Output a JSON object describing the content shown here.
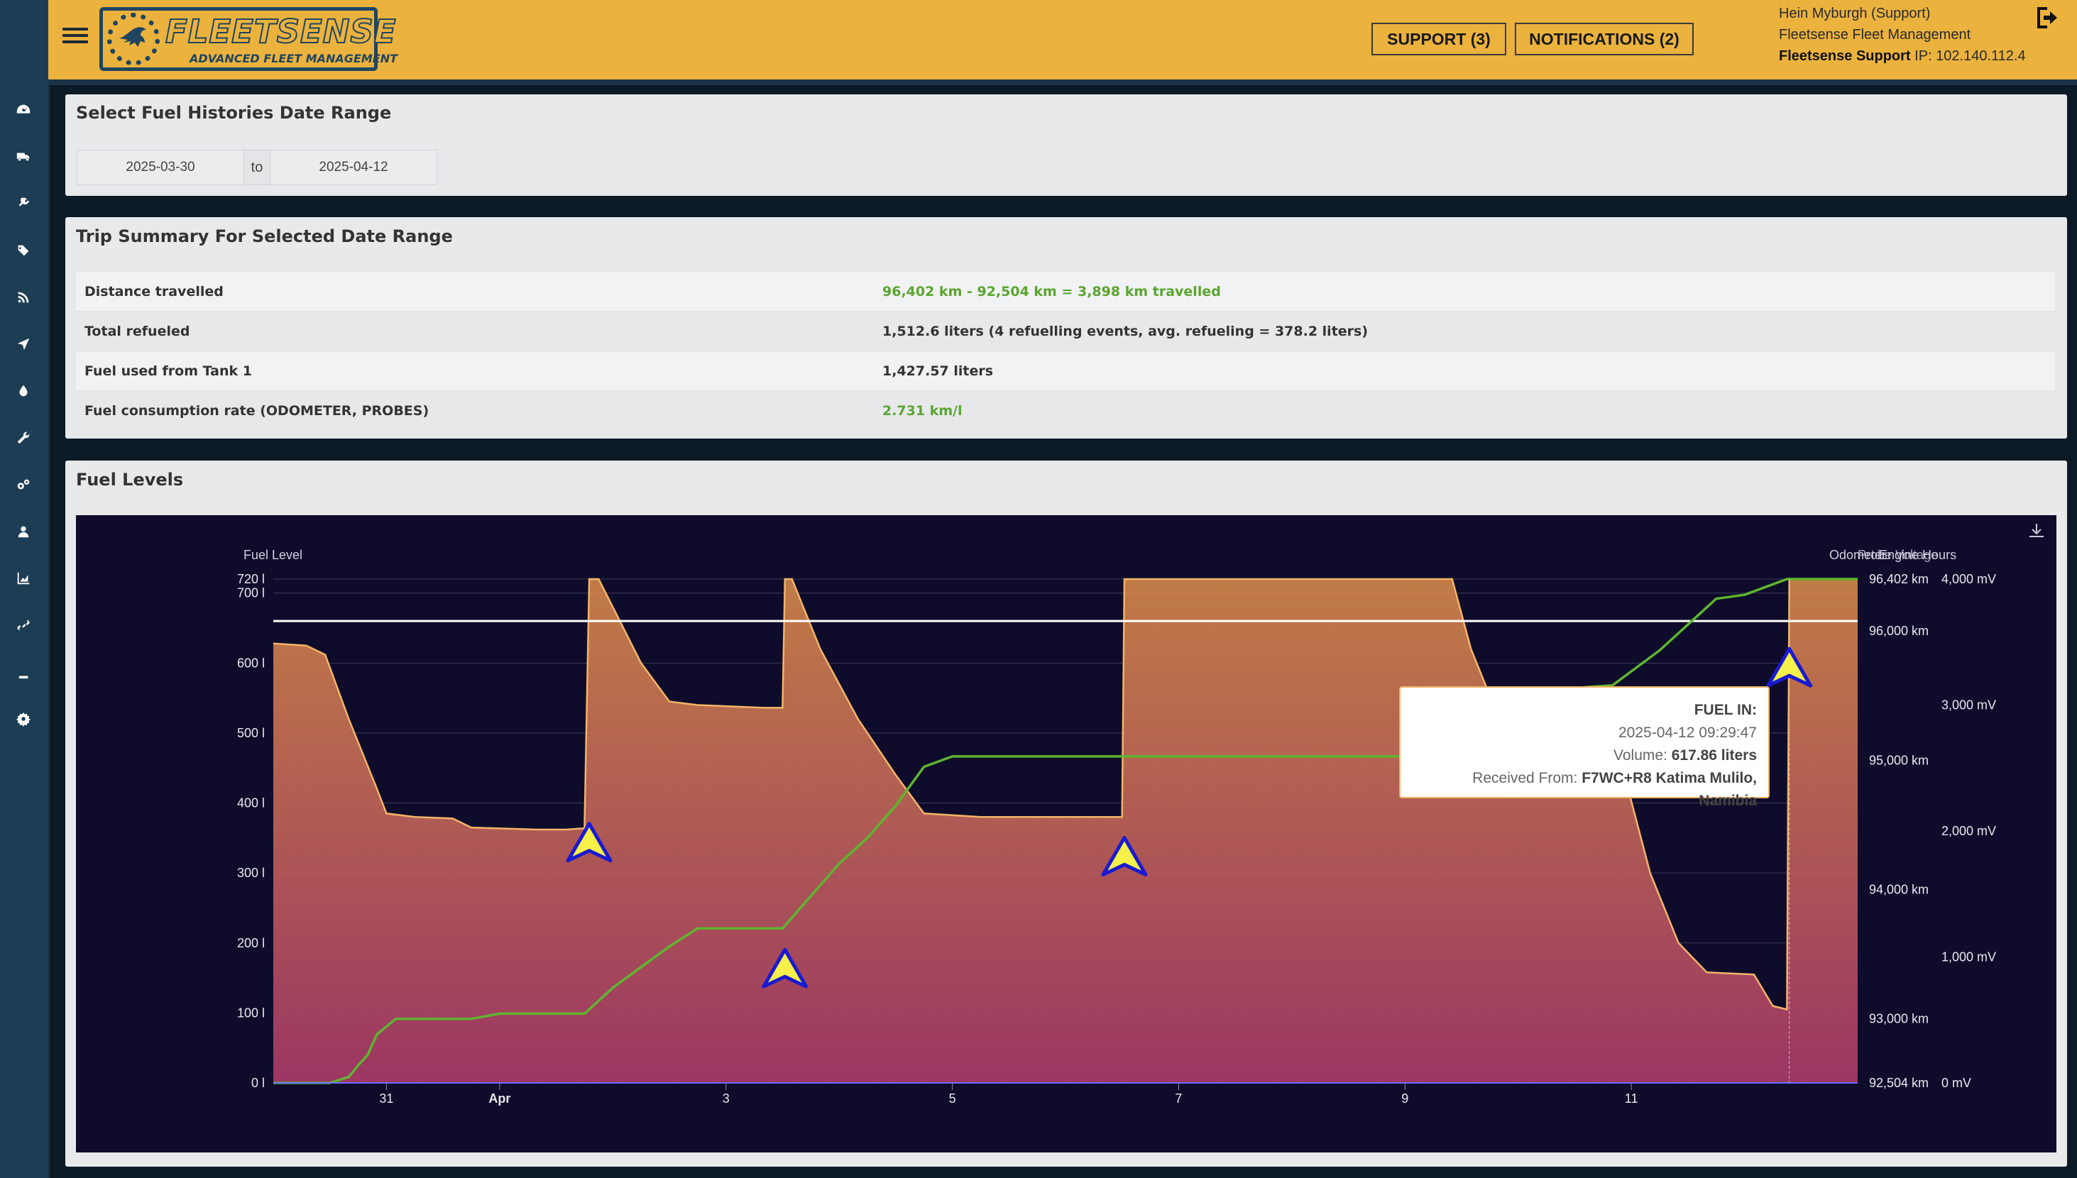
{
  "colors": {
    "header_bg": "#ebb23e",
    "sidebar_bg": "#1d3d54",
    "panel_bg": "#e8e9eb",
    "chart_bg": "#0e0c2a",
    "odometer_line": "#5fb52f",
    "fuel_area_top": "#d98a4a",
    "fuel_area_bottom": "#a83a68",
    "accent_green": "#5ba52f"
  },
  "sidebar": {
    "icons": [
      "dashboard-icon",
      "truck-icon",
      "plug-icon",
      "tags-icon",
      "rss-icon",
      "location-arrow-icon",
      "tint-icon",
      "wrench-icon",
      "gears-icon",
      "user-icon",
      "area-chart-icon",
      "link-icon",
      "book-icon",
      "cog-icon"
    ]
  },
  "header": {
    "menu_icon": "hamburger-icon",
    "logo_title": "FLEETSENSE",
    "logo_subtitle": "ADVANCED FLEET MANAGEMENT",
    "support_label": "SUPPORT (3)",
    "notifications_label": "NOTIFICATIONS (2)",
    "user_name": "Hein Myburgh (Support)",
    "company": "Fleetsense Fleet Management",
    "org": "Fleetsense Support",
    "ip_text": " IP: 102.140.112.4",
    "logout_icon": "sign-out-icon"
  },
  "date_range": {
    "title": "Select Fuel Histories Date Range",
    "from": "2025-03-30",
    "to_label": "to",
    "to": "2025-04-12"
  },
  "trip_summary": {
    "title": "Trip Summary For Selected Date Range",
    "rows": [
      {
        "label": "Distance travelled",
        "value": "96,402 km - 92,504 km = 3,898 km travelled",
        "highlight": true
      },
      {
        "label": "Total refueled",
        "value": "1,512.6 liters (4 refuelling events, avg. refueling = 378.2 liters)",
        "highlight": false
      },
      {
        "label": "Fuel used from Tank 1",
        "value": "1,427.57 liters",
        "highlight": false
      },
      {
        "label": "Fuel consumption rate (ODOMETER, PROBES)",
        "value": "2.731 km/l",
        "highlight": true
      }
    ]
  },
  "fuel_levels": {
    "title": "Fuel Levels",
    "download_icon": "download-icon"
  },
  "chart_data": {
    "type": "area",
    "title": "",
    "x_axis": {
      "start": "2025-03-30T00:00",
      "end": "2025-04-13T00:00",
      "ticks": [
        {
          "label": "31",
          "t": "2025-03-31T00:00"
        },
        {
          "label": "Apr",
          "t": "2025-04-01T00:00"
        },
        {
          "label": "3",
          "t": "2025-04-03T00:00"
        },
        {
          "label": "5",
          "t": "2025-04-05T00:00"
        },
        {
          "label": "7",
          "t": "2025-04-07T00:00"
        },
        {
          "label": "9",
          "t": "2025-04-09T00:00"
        },
        {
          "label": "11",
          "t": "2025-04-11T00:00"
        }
      ]
    },
    "y_left": {
      "label": "Fuel Level",
      "unit": "l",
      "range": [
        0,
        720
      ],
      "ticks": [
        {
          "label": "0 l",
          "v": 0
        },
        {
          "label": "100 l",
          "v": 100
        },
        {
          "label": "200 l",
          "v": 200
        },
        {
          "label": "300 l",
          "v": 300
        },
        {
          "label": "400 l",
          "v": 400
        },
        {
          "label": "500 l",
          "v": 500
        },
        {
          "label": "600 l",
          "v": 600
        },
        {
          "label": "700 l",
          "v": 700
        },
        {
          "label": "720 l",
          "v": 720
        }
      ]
    },
    "y_odometer": {
      "label": "Odometer",
      "range": [
        92504,
        96402
      ],
      "ticks": [
        {
          "label": "92,504 km",
          "v": 92504
        },
        {
          "label": "93,000 km",
          "v": 93000
        },
        {
          "label": "94,000 km",
          "v": 94000
        },
        {
          "label": "95,000 km",
          "v": 95000
        },
        {
          "label": "96,000 km",
          "v": 96000
        },
        {
          "label": "96,402 km",
          "v": 96402
        }
      ]
    },
    "y_engine": {
      "label_engine": "Engine Hours",
      "label_voltage": "Probe Voltage",
      "range": [
        0,
        4000
      ],
      "ticks": [
        {
          "label": "0 mV",
          "v": 0
        },
        {
          "label": "1,000 mV",
          "v": 1000
        },
        {
          "label": "2,000 mV",
          "v": 2000
        },
        {
          "label": "3,000 mV",
          "v": 3000
        },
        {
          "label": "4,000 mV",
          "v": 4000
        }
      ]
    },
    "fuel_series": {
      "name": "Fuel Level",
      "points": [
        [
          "2025-03-30T00:00",
          628
        ],
        [
          "2025-03-30T07:00",
          625
        ],
        [
          "2025-03-30T11:00",
          612
        ],
        [
          "2025-03-30T16:00",
          520
        ],
        [
          "2025-03-30T22:00",
          420
        ],
        [
          "2025-03-31T00:00",
          385
        ],
        [
          "2025-03-31T06:00",
          380
        ],
        [
          "2025-03-31T14:00",
          378
        ],
        [
          "2025-03-31T18:00",
          365
        ],
        [
          "2025-04-01T08:00",
          362
        ],
        [
          "2025-04-01T14:00",
          362
        ],
        [
          "2025-04-01T18:00",
          364
        ],
        [
          "2025-04-01T19:00",
          720
        ],
        [
          "2025-04-01T21:00",
          720
        ],
        [
          "2025-04-02T00:00",
          680
        ],
        [
          "2025-04-02T06:00",
          600
        ],
        [
          "2025-04-02T12:00",
          545
        ],
        [
          "2025-04-02T18:00",
          540
        ],
        [
          "2025-04-03T08:00",
          536
        ],
        [
          "2025-04-03T10:00",
          536
        ],
        [
          "2025-04-03T12:00",
          536
        ],
        [
          "2025-04-03T12:30",
          720
        ],
        [
          "2025-04-03T14:00",
          720
        ],
        [
          "2025-04-03T20:00",
          620
        ],
        [
          "2025-04-04T04:00",
          520
        ],
        [
          "2025-04-04T12:00",
          440
        ],
        [
          "2025-04-04T18:00",
          385
        ],
        [
          "2025-04-05T06:00",
          380
        ],
        [
          "2025-04-05T18:00",
          380
        ],
        [
          "2025-04-06T06:00",
          380
        ],
        [
          "2025-04-06T12:00",
          380
        ],
        [
          "2025-04-06T12:30",
          720
        ],
        [
          "2025-04-09T10:00",
          720
        ],
        [
          "2025-04-09T14:00",
          620
        ],
        [
          "2025-04-09T20:00",
          520
        ],
        [
          "2025-04-10T06:00",
          510
        ],
        [
          "2025-04-10T20:00",
          505
        ],
        [
          "2025-04-11T04:00",
          300
        ],
        [
          "2025-04-11T10:00",
          200
        ],
        [
          "2025-04-11T16:00",
          158
        ],
        [
          "2025-04-12T02:00",
          155
        ],
        [
          "2025-04-12T06:00",
          110
        ],
        [
          "2025-04-12T09:00",
          105
        ],
        [
          "2025-04-12T09:30",
          720
        ],
        [
          "2025-04-13T00:00",
          720
        ]
      ]
    },
    "odometer_series": {
      "name": "Odometer",
      "points": [
        [
          "2025-03-30T00:00",
          92504
        ],
        [
          "2025-03-30T12:00",
          92504
        ],
        [
          "2025-03-30T16:00",
          92550
        ],
        [
          "2025-03-30T18:00",
          92640
        ],
        [
          "2025-03-30T20:00",
          92720
        ],
        [
          "2025-03-30T22:00",
          92880
        ],
        [
          "2025-03-31T02:00",
          93000
        ],
        [
          "2025-03-31T12:00",
          93000
        ],
        [
          "2025-03-31T18:00",
          93000
        ],
        [
          "2025-04-01T00:00",
          93040
        ],
        [
          "2025-04-01T18:00",
          93040
        ],
        [
          "2025-04-02T00:00",
          93240
        ],
        [
          "2025-04-02T06:00",
          93400
        ],
        [
          "2025-04-02T12:00",
          93560
        ],
        [
          "2025-04-02T18:00",
          93700
        ],
        [
          "2025-04-03T06:00",
          93700
        ],
        [
          "2025-04-03T12:00",
          93700
        ],
        [
          "2025-04-03T18:00",
          93950
        ],
        [
          "2025-04-04T00:00",
          94200
        ],
        [
          "2025-04-04T06:00",
          94400
        ],
        [
          "2025-04-04T12:00",
          94650
        ],
        [
          "2025-04-04T18:00",
          94950
        ],
        [
          "2025-04-05T00:00",
          95030
        ],
        [
          "2025-04-05T12:00",
          95030
        ],
        [
          "2025-04-07T00:00",
          95030
        ],
        [
          "2025-04-09T00:00",
          95030
        ],
        [
          "2025-04-09T12:00",
          95035
        ],
        [
          "2025-04-10T00:00",
          95100
        ],
        [
          "2025-04-10T06:00",
          95300
        ],
        [
          "2025-04-10T12:00",
          95560
        ],
        [
          "2025-04-10T20:00",
          95580
        ],
        [
          "2025-04-11T06:00",
          95850
        ],
        [
          "2025-04-11T12:00",
          96050
        ],
        [
          "2025-04-11T18:00",
          96250
        ],
        [
          "2025-04-12T00:00",
          96280
        ],
        [
          "2025-04-12T09:00",
          96402
        ],
        [
          "2025-04-13T00:00",
          96402
        ]
      ]
    },
    "reference_line_value": 660,
    "refuel_markers": [
      {
        "t": "2025-04-01T19:00",
        "fuel_level": 340
      },
      {
        "t": "2025-04-03T12:30",
        "fuel_level": 160
      },
      {
        "t": "2025-04-06T12:30",
        "fuel_level": 320
      },
      {
        "t": "2025-04-12T09:30",
        "fuel_level": 590
      }
    ],
    "tooltip": {
      "title": "FUEL IN:",
      "datetime": "2025-04-12 09:29:47",
      "volume_label": "Volume: ",
      "volume_value": "617.86 liters",
      "received_label": "Received From: ",
      "received_value": "F7WC+R8 Katima Mulilo, Namibia"
    }
  }
}
